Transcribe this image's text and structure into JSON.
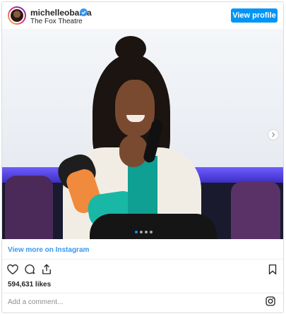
{
  "header": {
    "username": "michelleobama",
    "location": "The Fox Theatre",
    "verified_icon": "verified-badge-icon",
    "view_profile_label": "View profile"
  },
  "post": {
    "carousel": {
      "slide_count": 4,
      "active_slide": 1,
      "next_icon": "chevron-right-icon"
    }
  },
  "footer": {
    "view_more_label": "View more on Instagram",
    "likes_text": "594,631 likes",
    "comment_placeholder": "Add a comment...",
    "icons": [
      "heart-icon",
      "comment-icon",
      "share-icon",
      "bookmark-icon",
      "instagram-logo-icon"
    ]
  },
  "colors": {
    "accent": "#0095f6",
    "link": "#3897f0",
    "text": "#262626",
    "muted": "#8e8e8e"
  }
}
